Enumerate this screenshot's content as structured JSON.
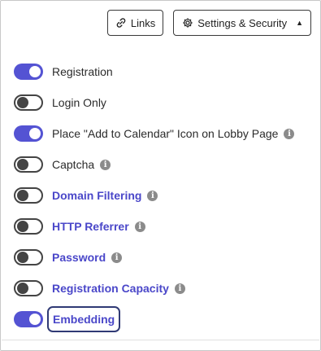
{
  "header": {
    "links_label": "Links",
    "settings_label": "Settings & Security"
  },
  "icons": {
    "links": "link-icon",
    "settings": "gear-icon",
    "caret": "caret-up-icon",
    "info": "info-icon"
  },
  "colors": {
    "accent": "#5453d3",
    "link_text": "#4a47c9",
    "toggle_off": "#444444",
    "info_icon": "#8b8b8b",
    "focus_ring": "#303a75"
  },
  "settings": [
    {
      "label": "Registration",
      "enabled": true,
      "info": false,
      "link": false
    },
    {
      "label": "Login Only",
      "enabled": false,
      "info": false,
      "link": false
    },
    {
      "label": "Place \"Add to Calendar\" Icon on Lobby Page",
      "enabled": true,
      "info": true,
      "link": false
    },
    {
      "label": "Captcha",
      "enabled": false,
      "info": true,
      "link": false
    },
    {
      "label": "Domain Filtering",
      "enabled": false,
      "info": true,
      "link": true
    },
    {
      "label": "HTTP Referrer",
      "enabled": false,
      "info": true,
      "link": true
    },
    {
      "label": "Password",
      "enabled": false,
      "info": true,
      "link": true
    },
    {
      "label": "Registration Capacity",
      "enabled": false,
      "info": true,
      "link": true
    },
    {
      "label": "Embedding",
      "enabled": true,
      "info": false,
      "link": true,
      "focused": true
    }
  ]
}
